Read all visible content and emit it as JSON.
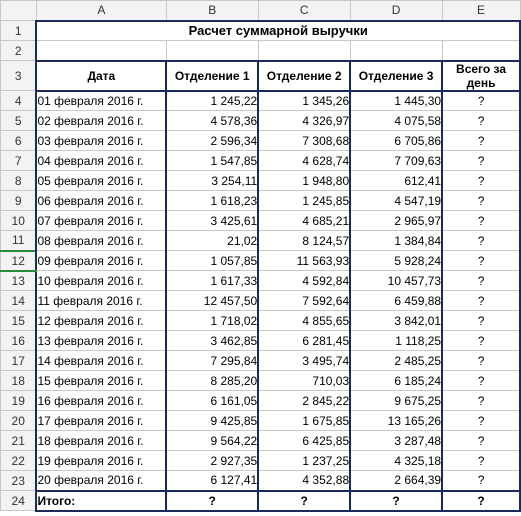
{
  "columns": [
    "A",
    "B",
    "C",
    "D",
    "E"
  ],
  "title": "Расчет суммарной выручки",
  "headers": {
    "date": "Дата",
    "dep1": "Отделение 1",
    "dep2": "Отделение 2",
    "dep3": "Отделение 3",
    "total": "Всего за день"
  },
  "rows": [
    {
      "date": "01 февраля 2016 г.",
      "d1": "1 245,22",
      "d2": "1 345,26",
      "d3": "1 445,30",
      "tot": "?"
    },
    {
      "date": "02 февраля 2016 г.",
      "d1": "4 578,36",
      "d2": "4 326,97",
      "d3": "4 075,58",
      "tot": "?"
    },
    {
      "date": "03 февраля 2016 г.",
      "d1": "2 596,34",
      "d2": "7 308,68",
      "d3": "6 705,86",
      "tot": "?"
    },
    {
      "date": "04 февраля 2016 г.",
      "d1": "1 547,85",
      "d2": "4 628,74",
      "d3": "7 709,63",
      "tot": "?"
    },
    {
      "date": "05 февраля 2016 г.",
      "d1": "3 254,11",
      "d2": "1 948,80",
      "d3": "612,41",
      "tot": "?"
    },
    {
      "date": "06 февраля 2016 г.",
      "d1": "1 618,23",
      "d2": "1 245,85",
      "d3": "4 547,19",
      "tot": "?"
    },
    {
      "date": "07 февраля 2016 г.",
      "d1": "3 425,61",
      "d2": "4 685,21",
      "d3": "2 965,97",
      "tot": "?"
    },
    {
      "date": "08 февраля 2016 г.",
      "d1": "21,02",
      "d2": "8 124,57",
      "d3": "1 384,84",
      "tot": "?"
    },
    {
      "date": "09 февраля 2016 г.",
      "d1": "1 057,85",
      "d2": "11 563,93",
      "d3": "5 928,24",
      "tot": "?"
    },
    {
      "date": "10 февраля 2016 г.",
      "d1": "1 617,33",
      "d2": "4 592,84",
      "d3": "10 457,73",
      "tot": "?"
    },
    {
      "date": "11 февраля 2016 г.",
      "d1": "12 457,50",
      "d2": "7 592,64",
      "d3": "6 459,88",
      "tot": "?"
    },
    {
      "date": "12 февраля 2016 г.",
      "d1": "1 718,02",
      "d2": "4 855,65",
      "d3": "3 842,01",
      "tot": "?"
    },
    {
      "date": "13 февраля 2016 г.",
      "d1": "3 462,85",
      "d2": "6 281,45",
      "d3": "1 118,25",
      "tot": "?"
    },
    {
      "date": "14 февраля 2016 г.",
      "d1": "7 295,84",
      "d2": "3 495,74",
      "d3": "2 485,25",
      "tot": "?"
    },
    {
      "date": "15 февраля 2016 г.",
      "d1": "8 285,20",
      "d2": "710,03",
      "d3": "6 185,24",
      "tot": "?"
    },
    {
      "date": "16 февраля 2016 г.",
      "d1": "6 161,05",
      "d2": "2 845,22",
      "d3": "9 675,25",
      "tot": "?"
    },
    {
      "date": "17 февраля 2016 г.",
      "d1": "9 425,85",
      "d2": "1 675,85",
      "d3": "13 165,26",
      "tot": "?"
    },
    {
      "date": "18 февраля 2016 г.",
      "d1": "9 564,22",
      "d2": "6 425,85",
      "d3": "3 287,48",
      "tot": "?"
    },
    {
      "date": "19 февраля 2016 г.",
      "d1": "2 927,35",
      "d2": "1 237,25",
      "d3": "4 325,18",
      "tot": "?"
    },
    {
      "date": "20 февраля 2016 г.",
      "d1": "6 127,41",
      "d2": "4 352,88",
      "d3": "2 664,39",
      "tot": "?"
    }
  ],
  "footer": {
    "label": "Итого:",
    "d1": "?",
    "d2": "?",
    "d3": "?",
    "tot": "?"
  },
  "row_labels": [
    "1",
    "2",
    "3",
    "4",
    "5",
    "6",
    "7",
    "8",
    "9",
    "10",
    "11",
    "12",
    "13",
    "14",
    "15",
    "16",
    "17",
    "18",
    "19",
    "20",
    "21",
    "22",
    "23",
    "24"
  ],
  "selected_row": "12",
  "chart_data": {
    "type": "table",
    "title": "Расчет суммарной выручки",
    "columns": [
      "Дата",
      "Отделение 1",
      "Отделение 2",
      "Отделение 3",
      "Всего за день"
    ],
    "rows": [
      [
        "01 февраля 2016 г.",
        1245.22,
        1345.26,
        1445.3,
        null
      ],
      [
        "02 февраля 2016 г.",
        4578.36,
        4326.97,
        4075.58,
        null
      ],
      [
        "03 февраля 2016 г.",
        2596.34,
        7308.68,
        6705.86,
        null
      ],
      [
        "04 февраля 2016 г.",
        1547.85,
        4628.74,
        7709.63,
        null
      ],
      [
        "05 февраля 2016 г.",
        3254.11,
        1948.8,
        612.41,
        null
      ],
      [
        "06 февраля 2016 г.",
        1618.23,
        1245.85,
        4547.19,
        null
      ],
      [
        "07 февраля 2016 г.",
        3425.61,
        4685.21,
        2965.97,
        null
      ],
      [
        "08 февраля 2016 г.",
        21.02,
        8124.57,
        1384.84,
        null
      ],
      [
        "09 февраля 2016 г.",
        1057.85,
        11563.93,
        5928.24,
        null
      ],
      [
        "10 февраля 2016 г.",
        1617.33,
        4592.84,
        10457.73,
        null
      ],
      [
        "11 февраля 2016 г.",
        12457.5,
        7592.64,
        6459.88,
        null
      ],
      [
        "12 февраля 2016 г.",
        1718.02,
        4855.65,
        3842.01,
        null
      ],
      [
        "13 февраля 2016 г.",
        3462.85,
        6281.45,
        1118.25,
        null
      ],
      [
        "14 февраля 2016 г.",
        7295.84,
        3495.74,
        2485.25,
        null
      ],
      [
        "15 февраля 2016 г.",
        8285.2,
        710.03,
        6185.24,
        null
      ],
      [
        "16 февраля 2016 г.",
        6161.05,
        2845.22,
        9675.25,
        null
      ],
      [
        "17 февраля 2016 г.",
        9425.85,
        1675.85,
        13165.26,
        null
      ],
      [
        "18 февраля 2016 г.",
        9564.22,
        6425.85,
        3287.48,
        null
      ],
      [
        "19 февраля 2016 г.",
        2927.35,
        1237.25,
        4325.18,
        null
      ],
      [
        "20 февраля 2016 г.",
        6127.41,
        4352.88,
        2664.39,
        null
      ]
    ],
    "footer": [
      "Итого:",
      null,
      null,
      null,
      null
    ]
  }
}
